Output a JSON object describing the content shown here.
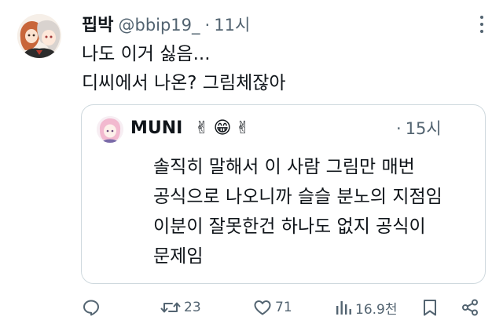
{
  "tweet": {
    "display_name": "핍박",
    "handle": "@bbip19_",
    "separator": "·",
    "time": "11시",
    "more_icon": "more-dots-icon",
    "lines": [
      "나도 이거 싫음...",
      "디씨에서 나온? 그림체잖아"
    ]
  },
  "quote": {
    "name": "MUNI",
    "emojis": [
      "✌",
      "😁",
      "✌"
    ],
    "separator": "·",
    "time": "15시",
    "lines": [
      "솔직히 말해서 이 사람 그림만 매번",
      "공식으로 나오니까 슬슬 분노의 지점임",
      "이분이 잘못한건 하나도 없지 공식이",
      "문제임"
    ]
  },
  "actions": {
    "reply_icon": "reply-icon",
    "retweet_icon": "retweet-icon",
    "retweets": "23",
    "like_icon": "heart-icon",
    "likes": "71",
    "views_icon": "views-chart-icon",
    "views": "16.9천",
    "bookmark_icon": "bookmark-icon",
    "share_icon": "share-icon"
  },
  "colors": {
    "text": "#0f1419",
    "secondary": "#536471",
    "border": "#cfd9de"
  }
}
